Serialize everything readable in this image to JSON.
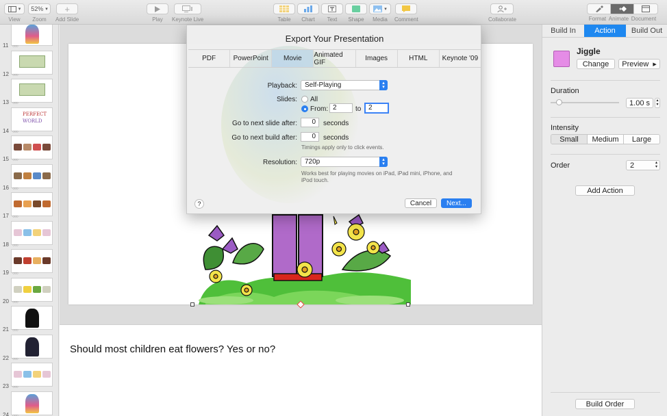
{
  "toolbar": {
    "view": "View",
    "zoom": "Zoom",
    "zoom_value": "52%",
    "add_slide": "Add Slide",
    "play": "Play",
    "keynote_live": "Keynote Live",
    "table": "Table",
    "chart": "Chart",
    "text": "Text",
    "shape": "Shape",
    "media": "Media",
    "comment": "Comment",
    "collaborate": "Collaborate",
    "format": "Format",
    "animate": "Animate",
    "document": "Document"
  },
  "navigator": {
    "slides": [
      {
        "num": "11",
        "kind": "character"
      },
      {
        "num": "12",
        "kind": "money"
      },
      {
        "num": "13",
        "kind": "money"
      },
      {
        "num": "14",
        "kind": "text-art",
        "thumb_text_1": "PERFECT",
        "thumb_text_2": "WORLD"
      },
      {
        "num": "15",
        "kind": "strip"
      },
      {
        "num": "16",
        "kind": "items"
      },
      {
        "num": "17",
        "kind": "animals"
      },
      {
        "num": "18",
        "kind": "cards"
      },
      {
        "num": "19",
        "kind": "cakes"
      },
      {
        "num": "20",
        "kind": "food"
      },
      {
        "num": "21",
        "kind": "silhouette"
      },
      {
        "num": "22",
        "kind": "family"
      },
      {
        "num": "23",
        "kind": "cards"
      },
      {
        "num": "24",
        "kind": "character"
      }
    ]
  },
  "notes": {
    "text": "Should most children eat flowers? Yes or no?"
  },
  "inspector": {
    "tabs": [
      "Build In",
      "Action",
      "Build Out"
    ],
    "active_tab": "Action",
    "effect_name": "Jiggle",
    "change_label": "Change",
    "preview_label": "Preview",
    "duration_label": "Duration",
    "duration_value": "1.00 s",
    "duration_level": 0.12,
    "intensity_label": "Intensity",
    "intensity_options": [
      "Small",
      "Medium",
      "Large"
    ],
    "intensity_selected": "Small",
    "order_label": "Order",
    "order_value": "2",
    "add_action_label": "Add Action",
    "build_order_label": "Build Order",
    "accent": "#1e88f0",
    "swatch_color": "#e58ce6"
  },
  "export_dialog": {
    "title": "Export Your Presentation",
    "tabs": [
      "PDF",
      "PowerPoint",
      "Movie",
      "Animated GIF",
      "Images",
      "HTML",
      "Keynote '09"
    ],
    "active_tab": "Movie",
    "playback_label": "Playback:",
    "playback_value": "Self-Playing",
    "slides_label": "Slides:",
    "all_label": "All",
    "from_label": "From:",
    "from_value": "2",
    "to_label": "to",
    "to_value": "2",
    "next_slide_label": "Go to next slide after:",
    "next_slide_value": "0",
    "next_build_label": "Go to next build after:",
    "next_build_value": "0",
    "seconds_label": "seconds",
    "timing_note": "Timings apply only to click events.",
    "resolution_label": "Resolution:",
    "resolution_value": "720p",
    "resolution_note": "Works best for playing movies on iPad, iPad mini, iPhone, and iPod touch.",
    "help_label": "?",
    "cancel_label": "Cancel",
    "next_label": "Next..."
  }
}
